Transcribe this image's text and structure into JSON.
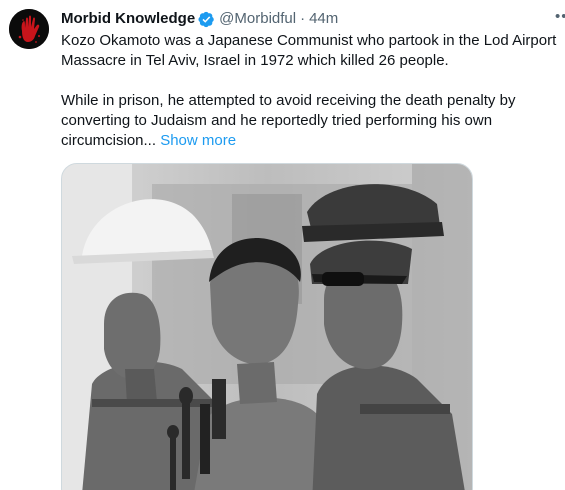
{
  "tweet": {
    "author": {
      "display_name": "Morbid Knowledge",
      "handle": "@Morbidful",
      "separator": "·",
      "timestamp": "44m",
      "verified_icon": "verified-badge-icon",
      "avatar_icon": "red-handprint-icon"
    },
    "more_icon": "ellipsis-icon",
    "paragraphs": [
      {
        "lines": [
          "Kozo Okamoto was a Japanese Communist who partook in the Lod Airport",
          "Massacre in Tel Aviv, Israel in 1972 which killed 26 people."
        ]
      },
      {
        "lines": [
          "While in prison, he attempted to avoid receiving the death penalty by",
          "converting to Judaism and he reportedly tried performing his own",
          "circumcision..."
        ]
      }
    ],
    "show_more_label": "Show more",
    "media_icon": "black-and-white-photo"
  },
  "colors": {
    "link": "#1d9bf0",
    "secondary_text": "#536471",
    "verified": "#1d9bf0",
    "avatar_hand": "#c8141b"
  }
}
